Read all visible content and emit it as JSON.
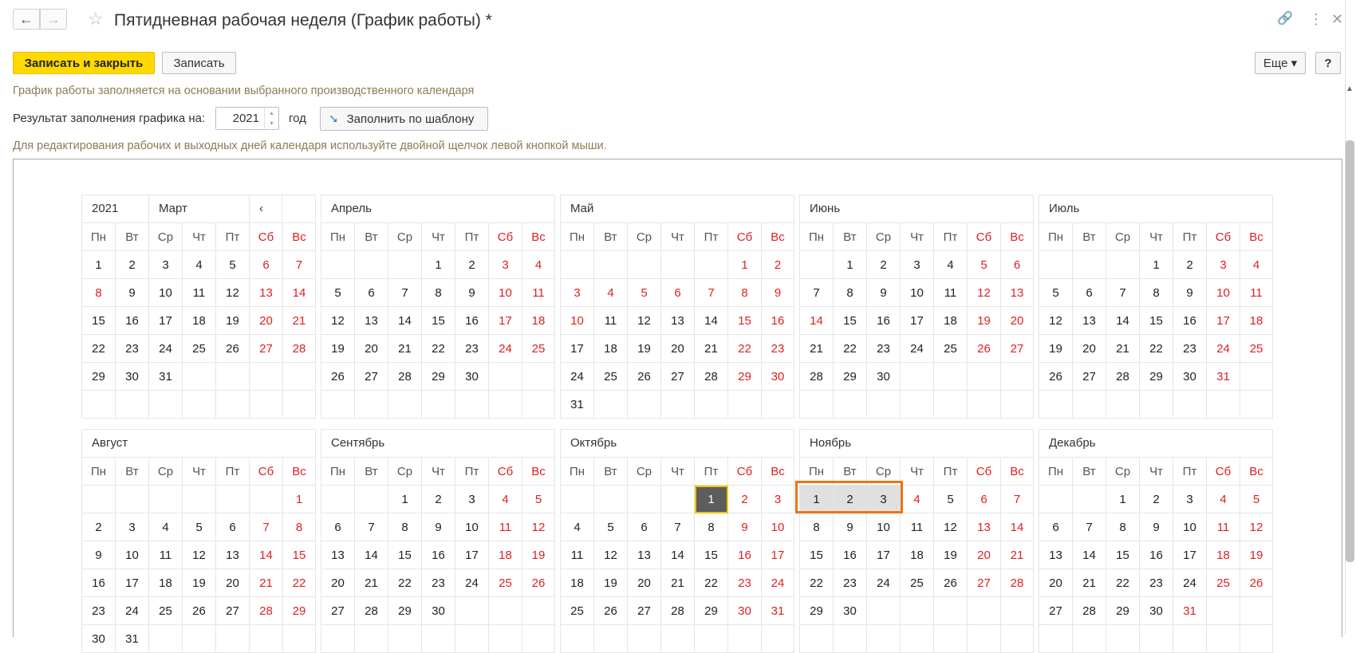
{
  "window": {
    "title": "Пятидневная рабочая неделя (График работы) *",
    "back_icon": "←",
    "forward_icon": "→",
    "favorite_icon": "☆",
    "link_icon": "🔗",
    "more_icon": "⋮",
    "close_icon": "✕"
  },
  "toolbar": {
    "save_close": "Записать и закрыть",
    "save": "Записать",
    "more": "Еще ▾",
    "help": "?"
  },
  "info": {
    "basis_hint": "График работы заполняется на основании выбранного производственного календаря",
    "result_label": "Результат заполнения графика на:",
    "year_value": "2021",
    "year_suffix": "год",
    "fill_template": "Заполнить по шаблону",
    "edit_hint": "Для редактирования рабочих и выходных дней календаря используйте двойной щелчок левой кнопкой мыши."
  },
  "calendar": {
    "year": "2021",
    "selected_month": "Март",
    "prev_arrow": "‹",
    "weekdays": [
      "Пн",
      "Вт",
      "Ср",
      "Чт",
      "Пт",
      "Сб",
      "Вс"
    ],
    "months": [
      {
        "name": "Март",
        "start": 0,
        "days": 31,
        "holidays": [
          8
        ]
      },
      {
        "name": "Апрель",
        "start": 3,
        "days": 30,
        "holidays": []
      },
      {
        "name": "Май",
        "start": 5,
        "days": 31,
        "holidays": [
          3,
          4,
          5,
          6,
          7,
          10
        ]
      },
      {
        "name": "Июнь",
        "start": 1,
        "days": 30,
        "holidays": [
          14
        ]
      },
      {
        "name": "Июль",
        "start": 3,
        "days": 31,
        "holidays": []
      },
      {
        "name": "Август",
        "start": 6,
        "days": 31,
        "holidays": []
      },
      {
        "name": "Сентябрь",
        "start": 2,
        "days": 30,
        "holidays": []
      },
      {
        "name": "Октябрь",
        "start": 4,
        "days": 31,
        "holidays": []
      },
      {
        "name": "Ноябрь",
        "start": 0,
        "days": 30,
        "holidays": [
          4
        ]
      },
      {
        "name": "Декабрь",
        "start": 2,
        "days": 31,
        "holidays": [
          31
        ]
      }
    ],
    "today": {
      "month": 7,
      "day": 1
    },
    "selected_days": {
      "month": 8,
      "days": [
        1,
        2,
        3
      ]
    }
  }
}
